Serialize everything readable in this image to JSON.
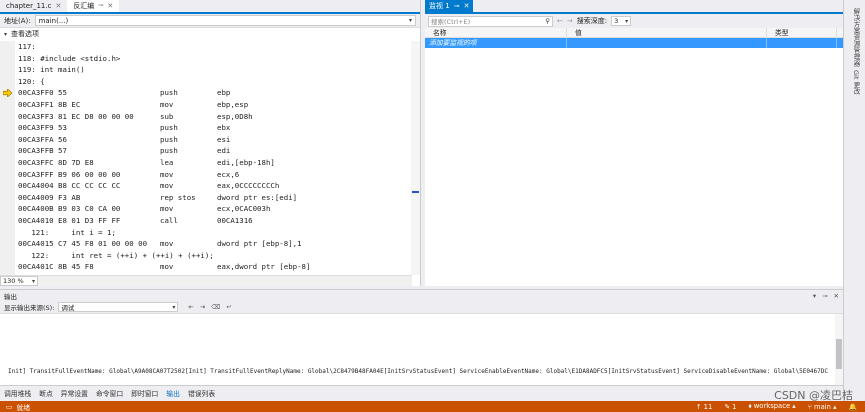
{
  "editor": {
    "tab_file": "chapter_11.c",
    "tab_disassembly": "反汇编",
    "address_label": "地址(A):",
    "address_value": "main(...)",
    "view_options": "查看选项",
    "zoom": "130 %"
  },
  "disassembly": [
    {
      "kind": "src",
      "text": "117:"
    },
    {
      "kind": "src",
      "text": "118: #include <stdio.h>"
    },
    {
      "kind": "src",
      "text": "119: int main()"
    },
    {
      "kind": "src",
      "text": "120: {"
    },
    {
      "kind": "asm",
      "addr": "00CA3FF0 55",
      "mn": "push",
      "op": "ebp",
      "current": true
    },
    {
      "kind": "asm",
      "addr": "00CA3FF1 8B EC",
      "mn": "mov",
      "op": "ebp,esp"
    },
    {
      "kind": "asm",
      "addr": "00CA3FF3 81 EC D8 00 00 00",
      "mn": "sub",
      "op": "esp,0D8h"
    },
    {
      "kind": "asm",
      "addr": "00CA3FF9 53",
      "mn": "push",
      "op": "ebx"
    },
    {
      "kind": "asm",
      "addr": "00CA3FFA 56",
      "mn": "push",
      "op": "esi"
    },
    {
      "kind": "asm",
      "addr": "00CA3FFB 57",
      "mn": "push",
      "op": "edi"
    },
    {
      "kind": "asm",
      "addr": "00CA3FFC 8D 7D E8",
      "mn": "lea",
      "op": "edi,[ebp-18h]"
    },
    {
      "kind": "asm",
      "addr": "00CA3FFF B9 06 00 00 00",
      "mn": "mov",
      "op": "ecx,6"
    },
    {
      "kind": "asm",
      "addr": "00CA4004 B8 CC CC CC CC",
      "mn": "mov",
      "op": "eax,0CCCCCCCCh"
    },
    {
      "kind": "asm",
      "addr": "00CA4009 F3 AB",
      "mn": "rep stos",
      "op": "dword ptr es:[edi]"
    },
    {
      "kind": "asm",
      "addr": "00CA400B B9 03 C0 CA 00",
      "mn": "mov",
      "op": "ecx,0CAC003h"
    },
    {
      "kind": "asm",
      "addr": "00CA4010 E8 01 D3 FF FF",
      "mn": "call",
      "op": "00CA1316"
    },
    {
      "kind": "src",
      "text": "   121:     int i = 1;"
    },
    {
      "kind": "asm",
      "addr": "00CA4015 C7 45 F8 01 00 00 00",
      "mn": "mov",
      "op": "dword ptr [ebp-8],1"
    },
    {
      "kind": "src",
      "text": "   122:     int ret = (++i) + (++i) + (++i);"
    },
    {
      "kind": "asm",
      "addr": "00CA401C 8B 45 F8",
      "mn": "mov",
      "op": "eax,dword ptr [ebp-8]"
    }
  ],
  "watch": {
    "tab_label": "监视 1",
    "search_placeholder": "搜索(Ctrl+E)",
    "depth_label": "搜索深度:",
    "depth_value": "3",
    "col_name": "名称",
    "col_value": "值",
    "col_type": "类型",
    "add_item": "添加要监视的项"
  },
  "side_strip": {
    "item1": "解决方案资源管理器",
    "item2": "Git 更改"
  },
  "output": {
    "title": "输出",
    "source_label": "显示输出来源(S):",
    "source_value": "调试",
    "text": "Init] TransitFullEventName: Global\\A9A08CA07T2502[Init] TransitFullEventReplyName: Global\\2C8479B48FA04E[InitSrvStatusEvent] ServiceEnableEventName: Global\\E1DA8ADFC5[InitSrvStatusEvent] ServiceDisableEventName: Global\\5E0467DC6D"
  },
  "bottom_tabs": [
    "调用堆栈",
    "断点",
    "异常设置",
    "命令窗口",
    "即时窗口",
    "输出",
    "错误列表"
  ],
  "bottom_active": "输出",
  "status": {
    "ready": "就绪",
    "up_count": "↑ 11",
    "edit": "✎ 1",
    "workspace": "workspace",
    "branch": "main"
  },
  "watermark": "CSDN @凌巴桔",
  "colors": {
    "status_bar": "#ca5100",
    "accent": "#007acc",
    "selection": "#3399ff"
  }
}
